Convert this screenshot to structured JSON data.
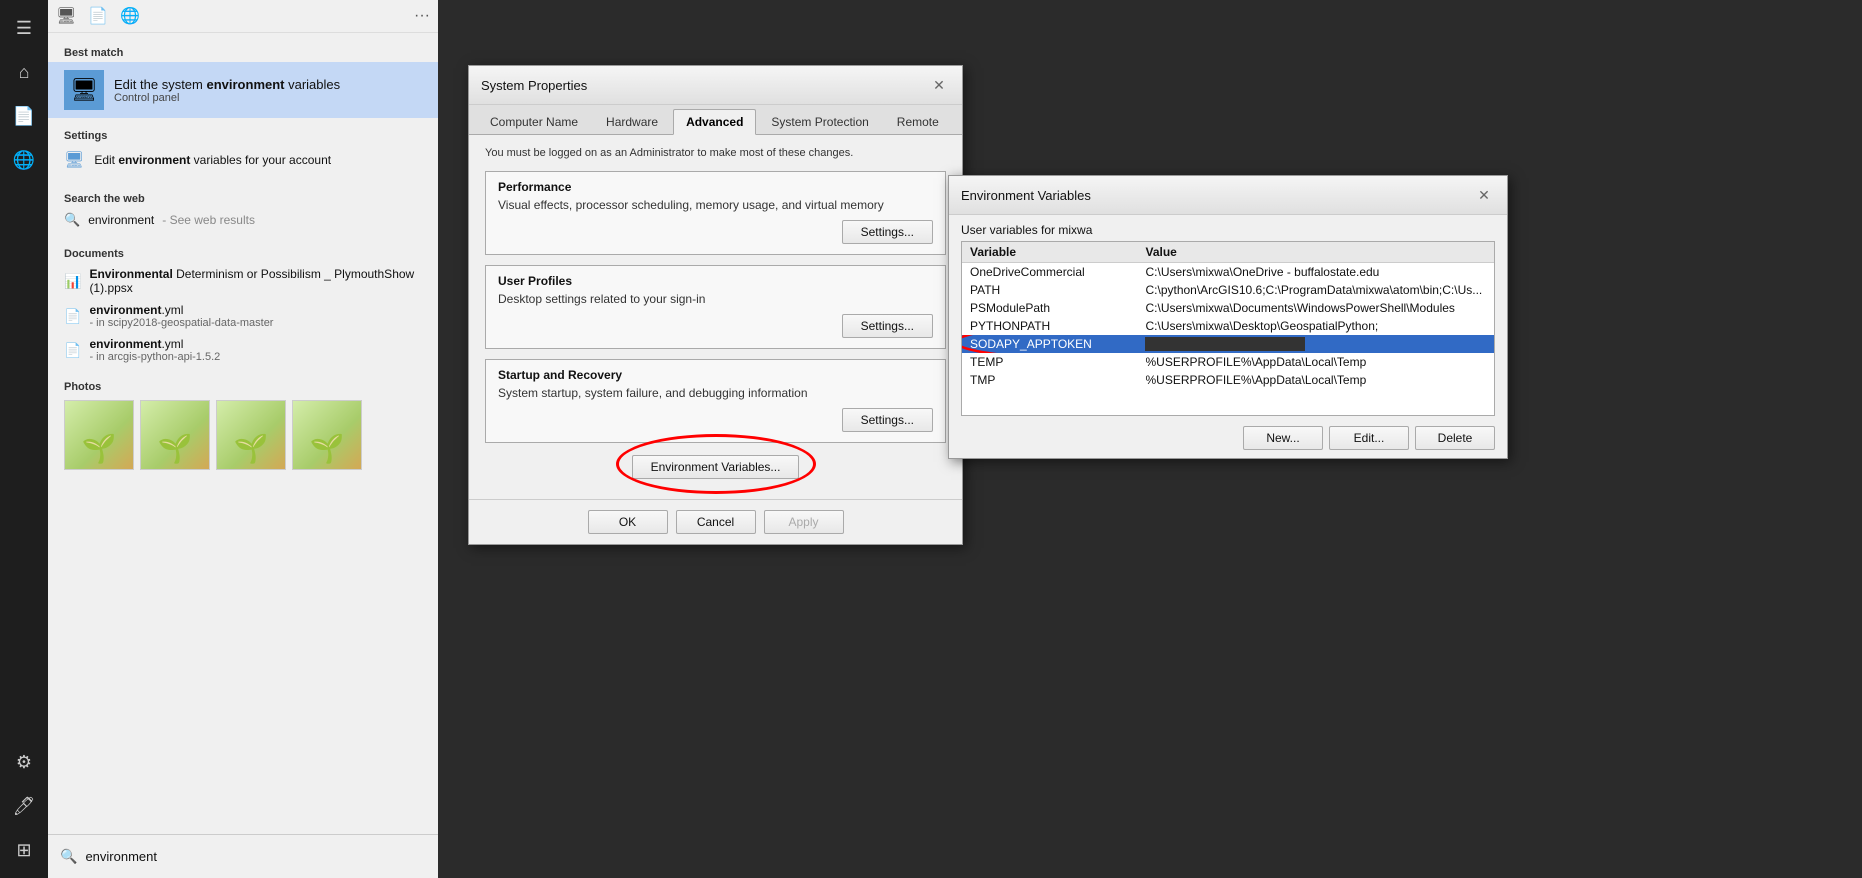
{
  "sidebar": {
    "icons": [
      "☰",
      "🖥",
      "📄",
      "🌐"
    ],
    "bottom_icons": [
      "⚙",
      "🖊",
      "⊞"
    ]
  },
  "search_panel": {
    "top_icons": [
      "🖥",
      "📄",
      "🌐"
    ],
    "best_match_label": "Best match",
    "best_match_title_plain": "Edit the system ",
    "best_match_title_bold": "environment",
    "best_match_title_suffix": " variables",
    "best_match_subtitle": "Control panel",
    "settings_label": "Settings",
    "settings_item": "Edit ",
    "settings_item_bold": "environment",
    "settings_item_suffix": " variables for your account",
    "web_label": "Search the web",
    "web_item": "environment",
    "web_item_sub": " - See web results",
    "docs_label": "Documents",
    "doc1_title": "Environmental",
    "doc1_suffix": " Determinism or Possibilism _ PlymouthShow (1).ppsx",
    "doc2_name": "environment.yml",
    "doc2_sub": " - in scipy2018-geospatial-data-master",
    "doc3_name": "environment.yml",
    "doc3_sub": " - in arcgis-python-api-1.5.2",
    "photos_label": "Photos",
    "search_query": "environment"
  },
  "system_props": {
    "title": "System Properties",
    "tabs": [
      "Computer Name",
      "Hardware",
      "Advanced",
      "System Protection",
      "Remote"
    ],
    "active_tab": "Advanced",
    "admin_note": "You must be logged on as an Administrator to make most of these changes.",
    "perf_title": "Performance",
    "perf_desc": "Visual effects, processor scheduling, memory usage, and virtual memory",
    "perf_btn": "Settings...",
    "profiles_title": "User Profiles",
    "profiles_desc": "Desktop settings related to your sign-in",
    "profiles_btn": "Settings...",
    "startup_title": "Startup and Recovery",
    "startup_desc": "System startup, system failure, and debugging information",
    "startup_btn": "Settings...",
    "env_btn": "Environment Variables...",
    "ok_btn": "OK",
    "cancel_btn": "Cancel",
    "apply_btn": "Apply"
  },
  "env_vars": {
    "title": "Environment Variables",
    "user_section_label": "User variables for mixwa",
    "col_variable": "Variable",
    "col_value": "Value",
    "user_vars": [
      {
        "var": "OneDriveCommercial",
        "value": "C:\\Users\\mixwa\\OneDrive - buffalostate.edu"
      },
      {
        "var": "PATH",
        "value": "C:\\python\\ArcGIS10.6;C:\\ProgramData\\mixwa\\atom\\bin;C:\\Us..."
      },
      {
        "var": "PSModulePath",
        "value": "C:\\Users\\mixwa\\Documents\\WindowsPowerShell\\Modules"
      },
      {
        "var": "PYTHONPATH",
        "value": "C:\\Users\\mixwa\\Desktop\\GeospatialPython;"
      },
      {
        "var": "SODAPY_APPTOKEN",
        "value": "████████████████████████",
        "selected": true
      },
      {
        "var": "TEMP",
        "value": "%USERPROFILE%\\AppData\\Local\\Temp"
      },
      {
        "var": "TMP",
        "value": "%USERPROFILE%\\AppData\\Local\\Temp"
      }
    ],
    "new_btn": "New...",
    "edit_btn": "Edit...",
    "delete_btn": "Delete"
  }
}
